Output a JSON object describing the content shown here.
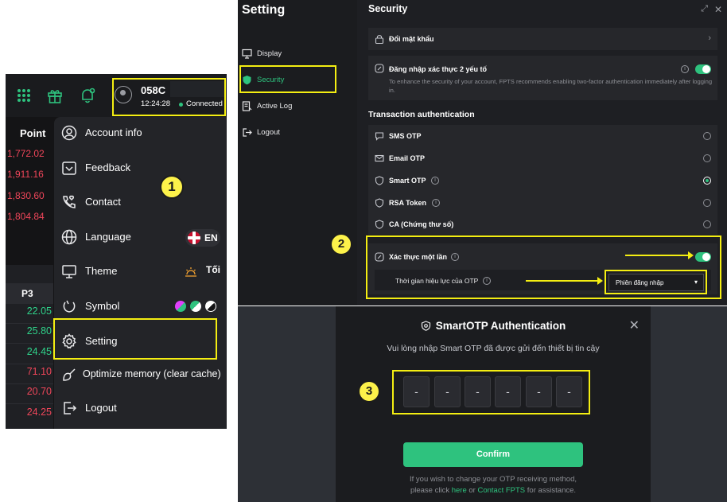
{
  "panel1": {
    "account": {
      "id": "058C",
      "time": "12:24:28",
      "status": "Connected"
    },
    "column_header": "Point",
    "points": [
      "1,772.02",
      "1,911.16",
      "1,830.60",
      "1,804.84"
    ],
    "sub_header": "P3",
    "values": [
      {
        "text": "22.05",
        "color": "#2fd28a"
      },
      {
        "text": "25.80",
        "color": "#2fd28a"
      },
      {
        "text": "24.45",
        "color": "#2fd28a"
      },
      {
        "text": "71.10",
        "color": "#f0465a"
      },
      {
        "text": "20.70",
        "color": "#f0465a"
      },
      {
        "text": "24.25",
        "color": "#f0465a"
      }
    ],
    "menu": {
      "account_info": "Account info",
      "feedback": "Feedback",
      "contact": "Contact",
      "language": "Language",
      "language_value": "EN",
      "theme": "Theme",
      "theme_value": "Tối",
      "symbol": "Symbol",
      "setting": "Setting",
      "optimize": "Optimize memory (clear cache)",
      "logout": "Logout"
    },
    "step": "1"
  },
  "panel2": {
    "title": "Setting",
    "sidebar": {
      "display": "Display",
      "security": "Security",
      "active_log": "Active Log",
      "logout": "Logout"
    },
    "section_title": "Security",
    "change_password": "Đổi mật khẩu",
    "two_factor": {
      "label": "Đăng nhập xác thực 2 yếu tố",
      "desc": "To enhance the security of your account, FPTS recommends enabling two-factor authentication immediately after logging in."
    },
    "transaction_heading": "Transaction authentication",
    "methods": {
      "sms": "SMS OTP",
      "email": "Email OTP",
      "smart": "Smart OTP",
      "rsa": "RSA Token",
      "ca": "CA (Chứng thư số)"
    },
    "one_time_auth": "Xác thực một lần",
    "otp_validity": "Thời gian hiệu lực của OTP",
    "otp_validity_value": "Phiên đăng nhập",
    "step": "2"
  },
  "panel3": {
    "title": "SmartOTP Authentication",
    "subtitle": "Vui lòng nhập Smart OTP đã được gửi đến thiết bị tin cậy",
    "otp_placeholder": "-",
    "confirm": "Confirm",
    "footer_line1": "If you wish to change your OTP receiving method,",
    "footer_pre": "please click",
    "footer_here": "here",
    "footer_or": "or",
    "footer_contact": "Contact FPTS",
    "footer_post": "for assistance.",
    "step": "3"
  },
  "colors": {
    "accent": "#2ec27e",
    "highlight": "#f4ee12",
    "negative": "#f0465a",
    "positive": "#2fd28a"
  }
}
